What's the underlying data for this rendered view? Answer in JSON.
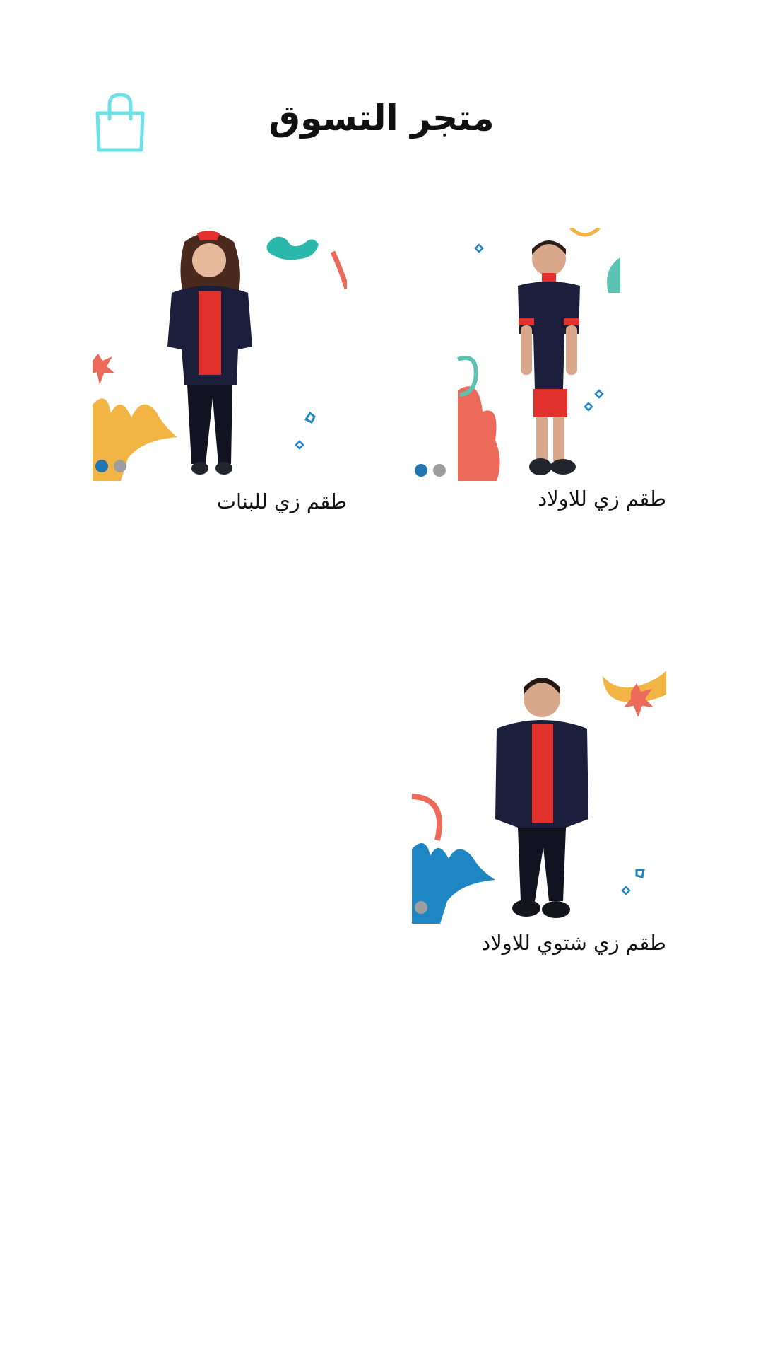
{
  "header": {
    "title": "متجر التسوق",
    "cart_icon": "shopping-bag-icon",
    "cart_icon_color": "#6ee0e6"
  },
  "products": [
    {
      "name": "طقم زي للاولاد",
      "image_icon": "boy-summer-uniform-photo",
      "carousel": {
        "count": 2,
        "active": 1
      }
    },
    {
      "name": "طقم زي للبنات",
      "image_icon": "girl-uniform-photo",
      "carousel": {
        "count": 2,
        "active": 1
      }
    },
    {
      "name": "طقم زي شتوي للاولاد",
      "image_icon": "boy-winter-uniform-photo",
      "carousel": {
        "count": 1,
        "active": 1
      }
    }
  ],
  "colors": {
    "dot_active": "#2374b3",
    "dot_inactive": "#9e9e9e",
    "accent_teal": "#2bb8ac",
    "accent_red": "#ec6a5a",
    "accent_yellow": "#f2b443",
    "accent_blue": "#1e86c3",
    "uniform_navy": "#1b1f3b",
    "uniform_red": "#e2302c"
  }
}
